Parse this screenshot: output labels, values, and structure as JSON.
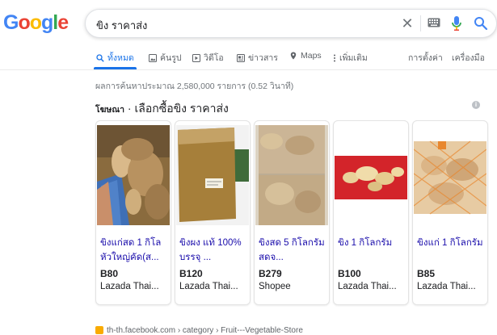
{
  "logo": {
    "letters": [
      "G",
      "o",
      "o",
      "g",
      "l",
      "e"
    ],
    "colors": [
      "#4285f4",
      "#ea4335",
      "#fbbc05",
      "#4285f4",
      "#34a853",
      "#ea4335"
    ]
  },
  "search": {
    "query": "ขิง ราคาส่ง",
    "clear_icon": "close-icon",
    "keyboard_icon": "keyboard-icon",
    "mic_icon": "mic-icon",
    "search_icon": "search-icon"
  },
  "tabs": [
    {
      "label": "ทั้งหมด",
      "icon": "search-icon",
      "active": true
    },
    {
      "label": "ค้นรูป",
      "icon": "image-icon",
      "active": false
    },
    {
      "label": "วิดีโอ",
      "icon": "video-icon",
      "active": false
    },
    {
      "label": "ข่าวสาร",
      "icon": "news-icon",
      "active": false
    },
    {
      "label": "Maps",
      "icon": "map-pin-icon",
      "active": false
    },
    {
      "label": "เพิ่มเติม",
      "icon": "more-vert-icon",
      "active": false
    }
  ],
  "tools": {
    "settings": "การตั้งค่า",
    "tools": "เครื่องมือ"
  },
  "result_stats": "ผลการค้นหาประมาณ 2,580,000 รายการ (0.52 วินาที)",
  "ads": {
    "label": "โฆษณา",
    "separator": "·",
    "title": "เลือกซื้อขิง ราคาส่ง",
    "info_icon": "info-icon"
  },
  "products": [
    {
      "title": "ขิงแก่สด 1 กิโล หัวใหญ่คัด(ส...",
      "price": "B80",
      "merchant": "Lazada Thai..."
    },
    {
      "title": "ขิงผง แท้ 100% บรรจุ ...",
      "price": "B120",
      "merchant": "Lazada Thai..."
    },
    {
      "title": "ขิงสด 5 กิโลกรัม สดจ...",
      "price": "B279",
      "merchant": "Shopee"
    },
    {
      "title": "ขิง 1 กิโลกรัม",
      "price": "B100",
      "merchant": "Lazada Thai..."
    },
    {
      "title": "ขิงแก่ 1 กิโลกรัม",
      "price": "B85",
      "merchant": "Lazada Thai..."
    }
  ],
  "bottom_result": "th-th.facebook.com › category › Fruit---Vegetable-Store"
}
